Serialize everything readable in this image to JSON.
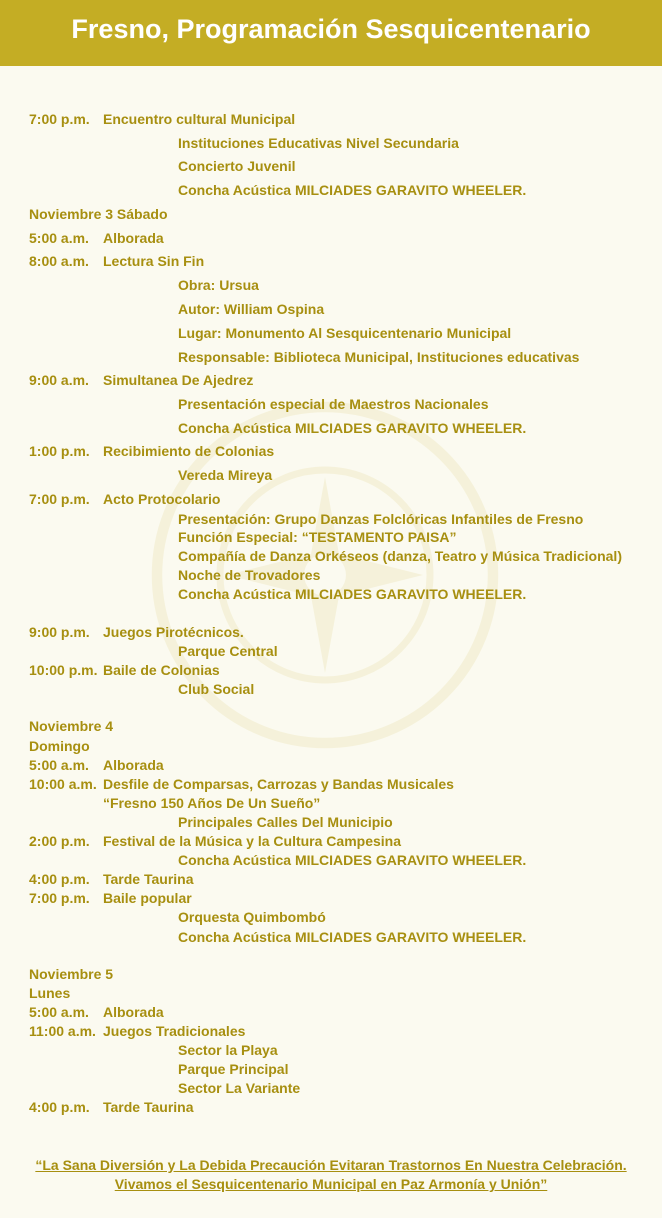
{
  "header": {
    "title": "Fresno, Programación Sesquicentenario"
  },
  "schedule": {
    "t1": "7:00 p.m.",
    "e1": "Encuentro cultural Municipal",
    "d1a": "Instituciones Educativas Nivel Secundaria",
    "d1b": "Concierto Juvenil",
    "d1c": "Concha Acústica MILCIADES GARAVITO WHEELER.",
    "day3": "Noviembre  3 Sábado",
    "t2": "5:00 a.m.",
    "e2": "Alborada",
    "t3": "8:00 a.m.",
    "e3": "Lectura Sin Fin",
    "d3a": "Obra: Ursua",
    "d3b": "Autor: William Ospina",
    "d3c": "Lugar: Monumento Al Sesquicentenario Municipal",
    "d3d": "Responsable: Biblioteca Municipal, Instituciones educativas",
    "t4": "9:00 a.m.",
    "e4": "Simultanea De Ajedrez",
    "d4a": "Presentación especial de Maestros Nacionales",
    "d4b": "Concha Acústica MILCIADES GARAVITO WHEELER.",
    "t5": "1:00 p.m.",
    "e5": "Recibimiento de Colonias",
    "d5a": "Vereda Mireya",
    "t6": "7:00 p.m.",
    "e6": "Acto Protocolario",
    "d6a": "Presentación: Grupo Danzas Folclóricas Infantiles de Fresno",
    "d6b": "Función Especial: “TESTAMENTO PAISA”",
    "d6c": "Compañía de Danza Orkéseos (danza, Teatro y Música Tradicional)",
    "d6d": "Noche de Trovadores",
    "d6e": "Concha Acústica MILCIADES GARAVITO WHEELER.",
    "t7": "9:00 p.m.",
    "e7": "Juegos Pirotécnicos.",
    "d7a": "Parque Central",
    "t8": "10:00 p.m.",
    "e8": "Baile de Colonias",
    "d8a": "Club Social",
    "day4a": "Noviembre 4",
    "day4b": "Domingo",
    "t9": "5:00 a.m.",
    "e9": "Alborada",
    "t10": "10:00 a.m.",
    "e10": "Desfile de Comparsas, Carrozas y Bandas Musicales",
    "e10b": "“Fresno 150 Años De Un Sueño”",
    "d10a": "Principales Calles Del Municipio",
    "t11": "2:00 p.m.",
    "e11": "Festival de la Música y la Cultura Campesina",
    "d11a": "Concha Acústica MILCIADES GARAVITO WHEELER.",
    "t12": "4:00 p.m.",
    "e12": "Tarde Taurina",
    "t13": "7:00 p.m.",
    "e13": "Baile popular",
    "d13a": "Orquesta Quimbombó",
    "d13b": "Concha Acústica MILCIADES GARAVITO WHEELER.",
    "day5a": "Noviembre 5",
    "day5b": "Lunes",
    "t14": "5:00 a.m.",
    "e14": "Alborada",
    "t15": "11:00 a.m.",
    "e15": "Juegos Tradicionales",
    "d15a": "Sector la Playa",
    "d15b": "Parque Principal",
    "d15c": "Sector La Variante",
    "t16": "4:00 p.m.",
    "e16": "Tarde Taurina"
  },
  "footer": {
    "line1": "“La Sana Diversión y La Debida Precaución Evitaran Trastornos En Nuestra Celebración.",
    "line2": "Vivamos el Sesquicentenario Municipal en Paz Armonía y Unión”"
  },
  "colors": {
    "banner": "#c4ad24",
    "text": "#a78f10",
    "background": "#fbfaf0"
  }
}
